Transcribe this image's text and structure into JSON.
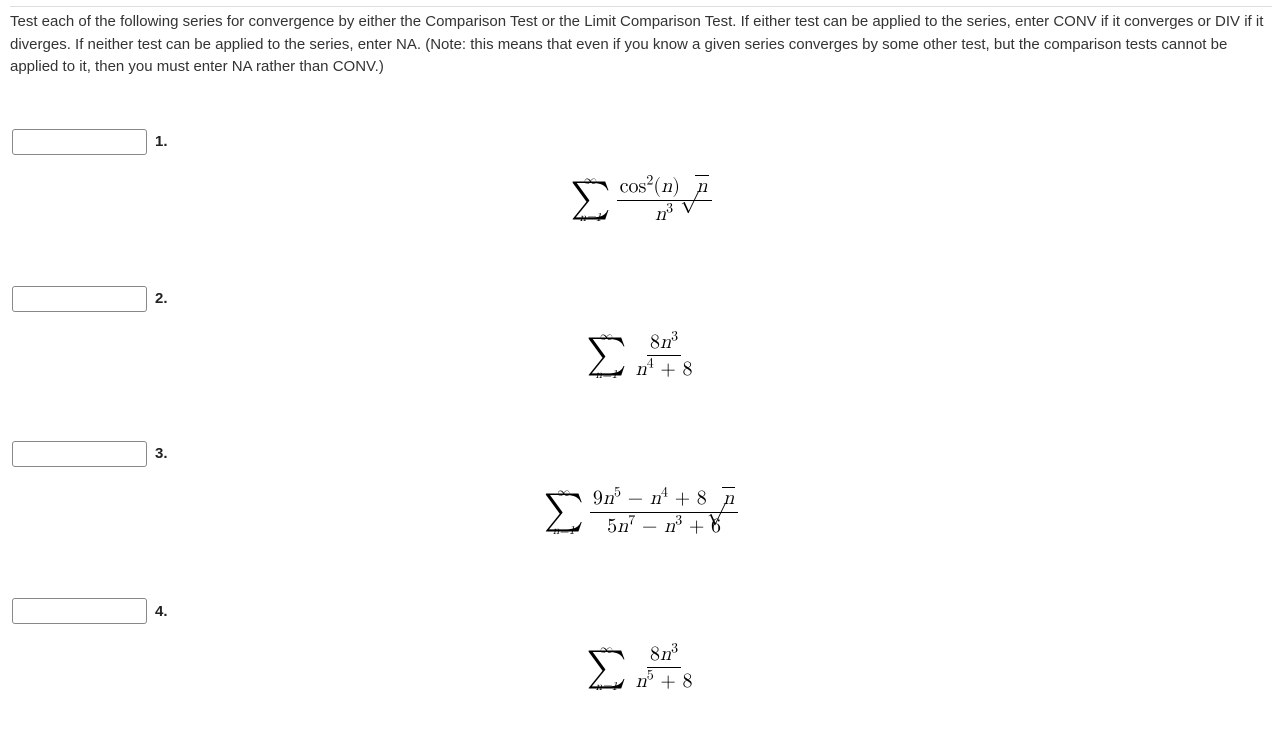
{
  "instructions": "Test each of the following series for convergence by either the Comparison Test or the Limit Comparison Test. If either test can be applied to the series, enter CONV if it converges or DIV if it diverges. If neither test can be applied to the series, enter NA. (Note: this means that even if you know a given series converges by some other test, but the comparison tests cannot be applied to it, then you must enter NA rather than CONV.)",
  "problems": [
    {
      "number": "1.",
      "answer": "",
      "sigma_top": "∞",
      "sigma_bottom": "n=1",
      "formula_description": "sum of cos^2(n) * sqrt(n) / n^3",
      "num_parts": {
        "cos": "cos",
        "arg": "n",
        "sqrt_arg": "n"
      },
      "den_parts": {
        "base": "n",
        "exp": "3"
      }
    },
    {
      "number": "2.",
      "answer": "",
      "sigma_top": "∞",
      "sigma_bottom": "n=1",
      "formula_description": "sum of 8n^3 / (n^4 + 8)",
      "num_parts": {
        "coef": "8",
        "base": "n",
        "exp": "3"
      },
      "den_parts": {
        "base": "n",
        "exp": "4",
        "plus": " + 8"
      }
    },
    {
      "number": "3.",
      "answer": "",
      "sigma_top": "∞",
      "sigma_bottom": "n=1",
      "formula_description": "sum of (9n^5 - n^4 + 8 sqrt(n)) / (5n^7 - n^3 + 6)",
      "num_parts": {
        "t1c": "9",
        "t1b": "n",
        "t1e": "5",
        "minus1": " − ",
        "t2b": "n",
        "t2e": "4",
        "plus1": " + 8",
        "sqrt_arg": "n"
      },
      "den_parts": {
        "t1c": "5",
        "t1b": "n",
        "t1e": "7",
        "minus1": " − ",
        "t2b": "n",
        "t2e": "3",
        "plus1": " + 6"
      }
    },
    {
      "number": "4.",
      "answer": "",
      "sigma_top": "∞",
      "sigma_bottom": "n=1",
      "formula_description": "sum of 8n^3 / (n^5 + 8)",
      "num_parts": {
        "coef": "8",
        "base": "n",
        "exp": "3"
      },
      "den_parts": {
        "base": "n",
        "exp": "5",
        "plus": " + 8"
      }
    }
  ]
}
